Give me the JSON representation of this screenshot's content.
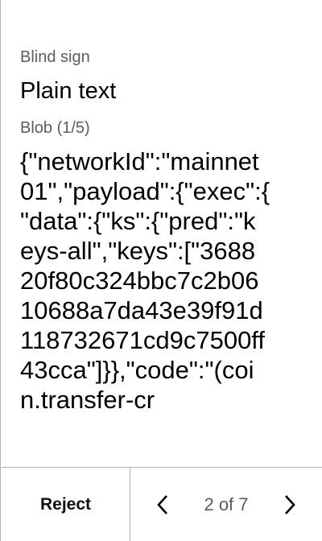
{
  "header": {
    "label": "Blind sign",
    "title": "Plain text",
    "blob_label": "Blob (1/5)"
  },
  "blob_lines": [
    "{\"networkId\":\"mainnet",
    "01\",\"payload\":{\"exec\":{",
    "\"data\":{\"ks\":{\"pred\":\"k",
    "eys-all\",\"keys\":[\"3688",
    "20f80c324bbc7c2b06",
    "10688a7da43e39f91d",
    "118732671cd9c7500ff",
    "43cca\"]}},\"code\":\"(coi",
    "n.transfer-cr"
  ],
  "footer": {
    "reject_label": "Reject",
    "page_indicator": "2 of 7",
    "prev_icon": "chevron-left-icon",
    "next_icon": "chevron-right-icon"
  }
}
